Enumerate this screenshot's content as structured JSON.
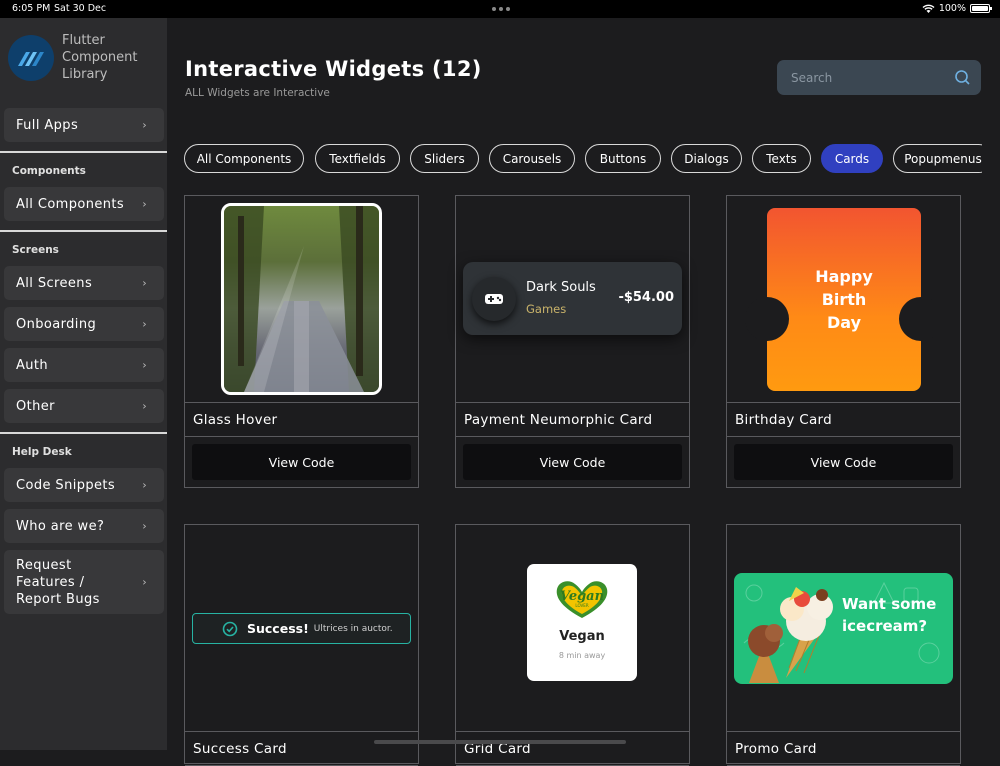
{
  "status_bar": {
    "time": "6:05 PM",
    "date": "Sat 30 Dec",
    "battery": "100%",
    "battery_level": 1.0
  },
  "sidebar": {
    "app_title": "Flutter Component Library",
    "full_apps": "Full Apps",
    "sections": {
      "components": {
        "title": "Components",
        "items": [
          "All Components"
        ]
      },
      "screens": {
        "title": "Screens",
        "items": [
          "All Screens",
          "Onboarding",
          "Auth",
          "Other"
        ]
      },
      "help_desk": {
        "title": "Help Desk",
        "items": [
          "Code Snippets",
          "Who are we?",
          "Request Features / Report Bugs"
        ]
      }
    }
  },
  "header": {
    "title": "Interactive Widgets (12)",
    "subtitle": "ALL Widgets are Interactive"
  },
  "search": {
    "placeholder": "Search"
  },
  "filters": [
    "All Components",
    "Textfields",
    "Sliders",
    "Carousels",
    "Buttons",
    "Dialogs",
    "Texts",
    "Cards",
    "Popupmenus"
  ],
  "active_filter": "Cards",
  "accent_color": "#3040c0",
  "cards": [
    {
      "title": "Glass Hover",
      "button": "View Code"
    },
    {
      "title": "Payment Neumorphic Card",
      "button": "View Code",
      "preview": {
        "name": "Dark Souls",
        "category": "Games",
        "amount": "-$54.00"
      }
    },
    {
      "title": "Birthday Card",
      "button": "View Code",
      "preview": {
        "text": "Happy Birth Day"
      }
    },
    {
      "title": "Success Card",
      "preview": {
        "label": "Success!",
        "message": "Ultrices in auctor."
      }
    },
    {
      "title": "Grid Card",
      "preview": {
        "logo_text": "Vegan",
        "logo_sub": "LOVER",
        "name": "Vegan",
        "subtitle": "8 min away"
      }
    },
    {
      "title": "Promo Card",
      "preview": {
        "text": "Want some icecream?"
      }
    }
  ]
}
